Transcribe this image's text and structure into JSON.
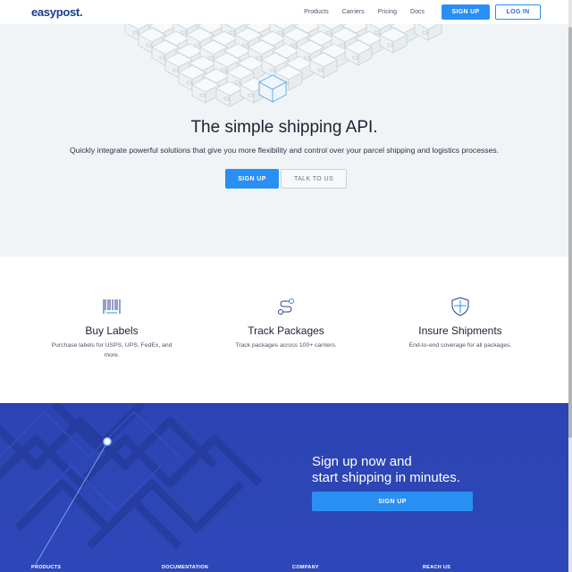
{
  "nav": {
    "logo": "easypost.",
    "links": [
      "Products",
      "Carriers",
      "Pricing",
      "Docs"
    ],
    "signup_label": "SIGN UP",
    "login_label": "LOG IN"
  },
  "hero": {
    "title": "The simple shipping API.",
    "subtitle": "Quickly integrate powerful solutions that give you more flexibility and control over your parcel shipping and logistics processes.",
    "signup_label": "SIGN UP",
    "talk_label": "TALK TO US"
  },
  "features": [
    {
      "icon": "barcode-icon",
      "title": "Buy Labels",
      "desc": "Purchase labels for USPS, UPS, FedEx, and more."
    },
    {
      "icon": "route-icon",
      "title": "Track Packages",
      "desc": "Track packages across 100+ carriers."
    },
    {
      "icon": "shield-icon",
      "title": "Insure Shipments",
      "desc": "End-to-end coverage for all packages."
    }
  ],
  "cta": {
    "title_line1": "Sign up now and",
    "title_line2": "start shipping in minutes.",
    "button_label": "SIGN UP"
  },
  "footer": {
    "headings": [
      "PRODUCTS",
      "DOCUMENTATION",
      "COMPANY",
      "REACH US"
    ]
  },
  "colors": {
    "accent": "#2a8ff3",
    "brand_navy": "#1c3a8c",
    "cta_bg": "#2e47b8",
    "hero_bg": "#f0f4f6"
  }
}
